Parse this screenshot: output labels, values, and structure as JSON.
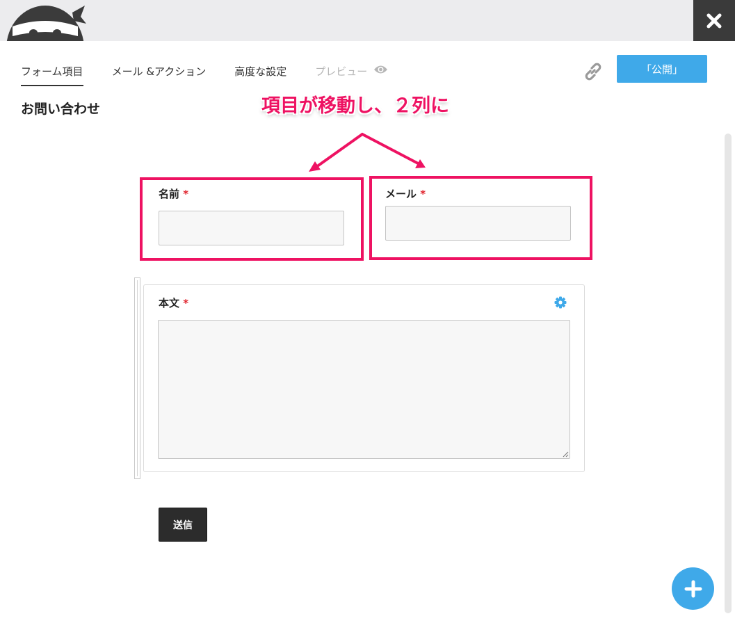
{
  "header": {
    "close_icon": "close-icon",
    "logo": "ninja-logo"
  },
  "tabs": [
    {
      "label": "フォーム項目",
      "active": true
    },
    {
      "label": "メール &アクション",
      "active": false
    },
    {
      "label": "高度な設定",
      "active": false
    },
    {
      "label": "プレビュー",
      "active": false,
      "icon": "eye-icon"
    }
  ],
  "toolbar": {
    "link_icon": "link-icon",
    "publish_label": "「公開」",
    "publish_color": "#3fa9e9"
  },
  "form": {
    "title": "お問い合わせ",
    "fields": [
      {
        "label": "名前",
        "required_mark": "*",
        "type": "text"
      },
      {
        "label": "メール",
        "required_mark": "*",
        "type": "text"
      },
      {
        "label": "本文",
        "required_mark": "*",
        "type": "textarea",
        "settings_icon": "gear-icon"
      }
    ],
    "submit_label": "送信"
  },
  "annotation": {
    "text": "項目が移動し、２列に",
    "color": "#ee1262"
  },
  "add_button_icon": "plus-icon"
}
